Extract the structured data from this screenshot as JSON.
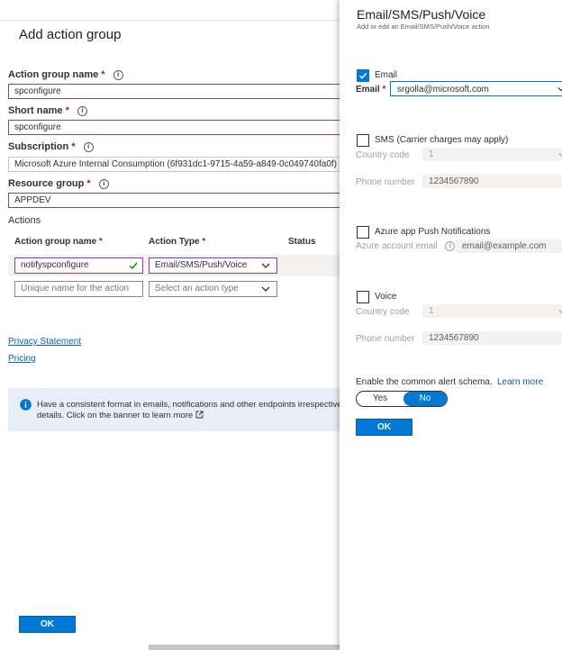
{
  "left": {
    "title": "Add action group",
    "fields": {
      "action_group_name": {
        "label": "Action group name",
        "value": "spconfigure"
      },
      "short_name": {
        "label": "Short name",
        "value": "spconfigure"
      },
      "subscription": {
        "label": "Subscription",
        "value": "Microsoft Azure Internal Consumption (6f931dc1-9715-4a59-a849-0c049740fa0f)"
      },
      "resource_group": {
        "label": "Resource group",
        "value": "APPDEV"
      }
    },
    "actions": {
      "title": "Actions",
      "headers": {
        "name": "Action group name",
        "type": "Action Type",
        "status": "Status"
      },
      "rows": [
        {
          "name": "notifyspconfigure",
          "type": "Email/SMS/Push/Voice"
        }
      ],
      "new_row": {
        "name_placeholder": "Unique name for the action",
        "type_placeholder": "Select an action type"
      }
    },
    "links": {
      "privacy": "Privacy Statement",
      "pricing": "Pricing"
    },
    "banner": {
      "text_line1": "Have a consistent format in emails, notifications and other endpoints irrespective",
      "text_line2": "details. Click on the banner to learn more"
    },
    "ok_label": "OK"
  },
  "right": {
    "title": "Email/SMS/Push/Voice",
    "subtitle": "Add or edit an Email/SMS/Push/Voice action",
    "email": {
      "checkbox_label": "Email",
      "checked": true,
      "field_label": "Email",
      "value": "srgolla@microsoft.com"
    },
    "sms": {
      "checkbox_label": "SMS (Carrier charges may apply)",
      "checked": false,
      "country_label": "Country code",
      "country_value": "1",
      "phone_label": "Phone number",
      "phone_value": "1234567890"
    },
    "push": {
      "checkbox_label": "Azure app Push Notifications",
      "checked": false,
      "account_label": "Azure account email",
      "account_placeholder": "email@example.com"
    },
    "voice": {
      "checkbox_label": "Voice",
      "checked": false,
      "country_label": "Country code",
      "country_value": "1",
      "phone_label": "Phone number",
      "phone_value": "1234567890"
    },
    "schema": {
      "label": "Enable the common alert schema.",
      "learn_more": "Learn more",
      "toggle_yes": "Yes",
      "toggle_no": "No",
      "selected": "No"
    },
    "ok_label": "OK"
  },
  "colors": {
    "accent": "#0078d4",
    "focus_border": "#8b3d9a",
    "required": "#a4262c",
    "link": "#0064b4",
    "success": "#107c10"
  }
}
